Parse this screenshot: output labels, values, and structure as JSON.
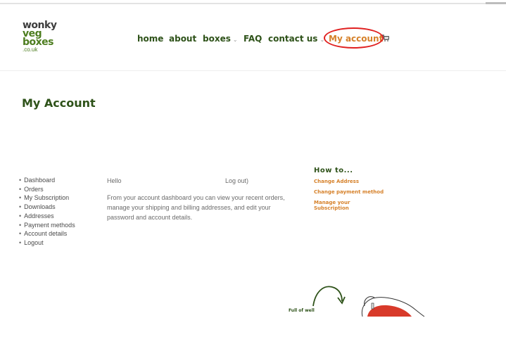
{
  "logo": {
    "line1": "wonky",
    "line2": "veg",
    "line3": "boxes",
    "line4": ".co.uk"
  },
  "nav": {
    "home": "home",
    "about": "about",
    "boxes": "boxes",
    "faq": "FAQ",
    "contact": "contact us",
    "account": "My account",
    "dropdown_chevron": "⌄"
  },
  "page": {
    "title": "My Account"
  },
  "account_nav": [
    "Dashboard",
    "Orders",
    "My Subscription",
    "Downloads",
    "Addresses",
    "Payment methods",
    "Account details",
    "Logout"
  ],
  "dashboard": {
    "hello": "Hello",
    "logout": "Log out)",
    "description": "From your account dashboard you can view your recent orders, manage your shipping and billing addresses, and edit your password and account details."
  },
  "howto": {
    "title": "How to...",
    "links": [
      "Change Address",
      "Change payment method",
      "Manage your Subscription"
    ]
  },
  "illustration": {
    "caption": "Full of well"
  },
  "colors": {
    "brand_green": "#2e5219",
    "accent_orange": "#d6812a",
    "highlight_ring": "#e02020"
  }
}
